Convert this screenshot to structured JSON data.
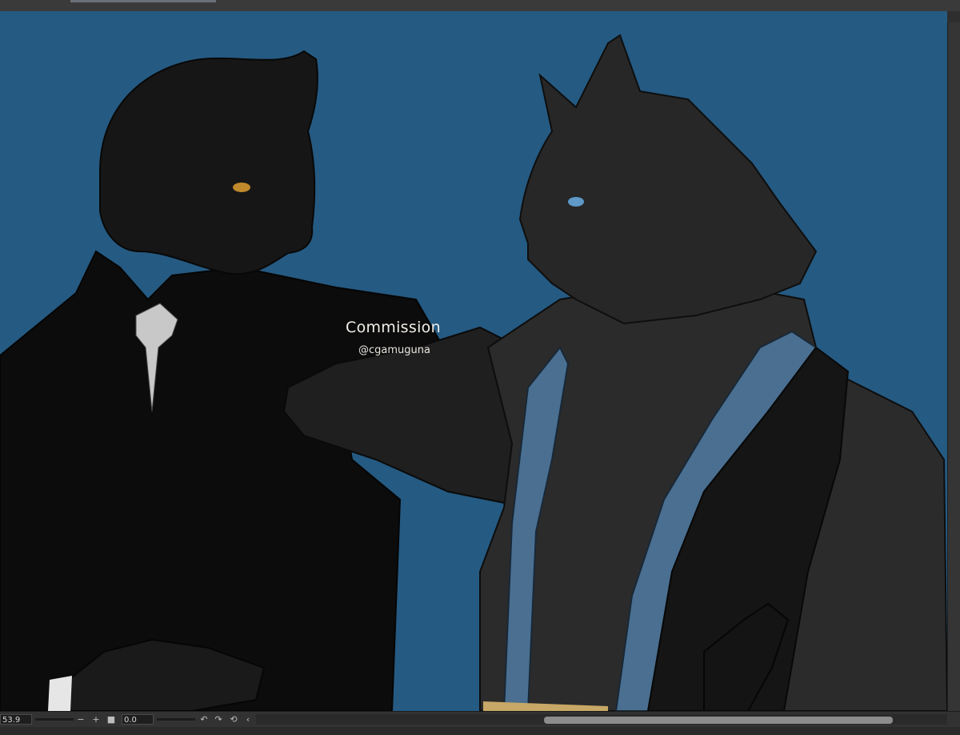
{
  "canvas": {
    "background_color": "#255a82",
    "watermark_title": "Commission",
    "watermark_handle": "@cgamuguna"
  },
  "status_bar": {
    "zoom_value": "53.9",
    "rotation_value": "0.0",
    "icons": {
      "zoom_out": "minus-icon",
      "zoom_in": "plus-icon",
      "fit": "square-icon",
      "rotate_left": "rotate-left-icon",
      "rotate_right": "rotate-right-icon",
      "reset_rotation": "reset-icon",
      "collapse": "chevron-left-icon"
    },
    "glyphs": {
      "zoom_out": "−",
      "zoom_in": "+",
      "fit": "■",
      "rotate_left": "↶",
      "rotate_right": "↷",
      "reset_rotation": "⟲",
      "collapse": "‹"
    }
  }
}
